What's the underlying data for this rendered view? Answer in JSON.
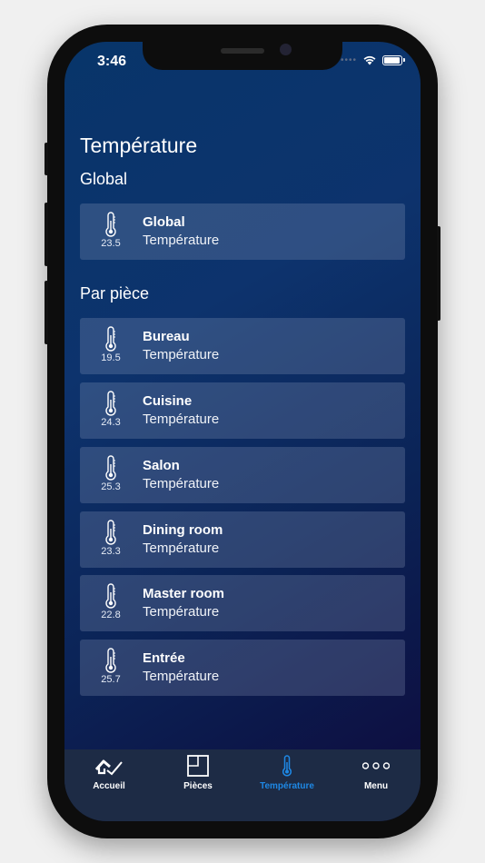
{
  "status": {
    "time": "3:46"
  },
  "page": {
    "title": "Température"
  },
  "sections": {
    "global_title": "Global",
    "rooms_title": "Par pièce"
  },
  "global_card": {
    "name": "Global",
    "subtitle": "Température",
    "value": "23.5",
    "icon": "thermometer-icon"
  },
  "rooms": [
    {
      "name": "Bureau",
      "subtitle": "Température",
      "value": "19.5",
      "icon": "thermometer-icon"
    },
    {
      "name": "Cuisine",
      "subtitle": "Température",
      "value": "24.3",
      "icon": "thermometer-icon"
    },
    {
      "name": "Salon",
      "subtitle": "Température",
      "value": "25.3",
      "icon": "thermometer-icon"
    },
    {
      "name": "Dining room",
      "subtitle": "Température",
      "value": "23.3",
      "icon": "thermometer-icon"
    },
    {
      "name": "Master room",
      "subtitle": "Température",
      "value": "22.8",
      "icon": "thermometer-icon"
    },
    {
      "name": "Entrée",
      "subtitle": "Température",
      "value": "25.7",
      "icon": "thermometer-icon"
    }
  ],
  "tabbar": {
    "items": [
      {
        "label": "Accueil",
        "icon": "home-check-icon",
        "active": false
      },
      {
        "label": "Pièces",
        "icon": "floorplan-icon",
        "active": false
      },
      {
        "label": "Température",
        "icon": "thermometer-icon",
        "active": true
      },
      {
        "label": "Menu",
        "icon": "more-icon",
        "active": false
      }
    ]
  },
  "colors": {
    "accent": "#1e88e5",
    "tabbar_bg": "#1d2b45",
    "card_bg": "rgba(160,170,200,0.24)"
  }
}
